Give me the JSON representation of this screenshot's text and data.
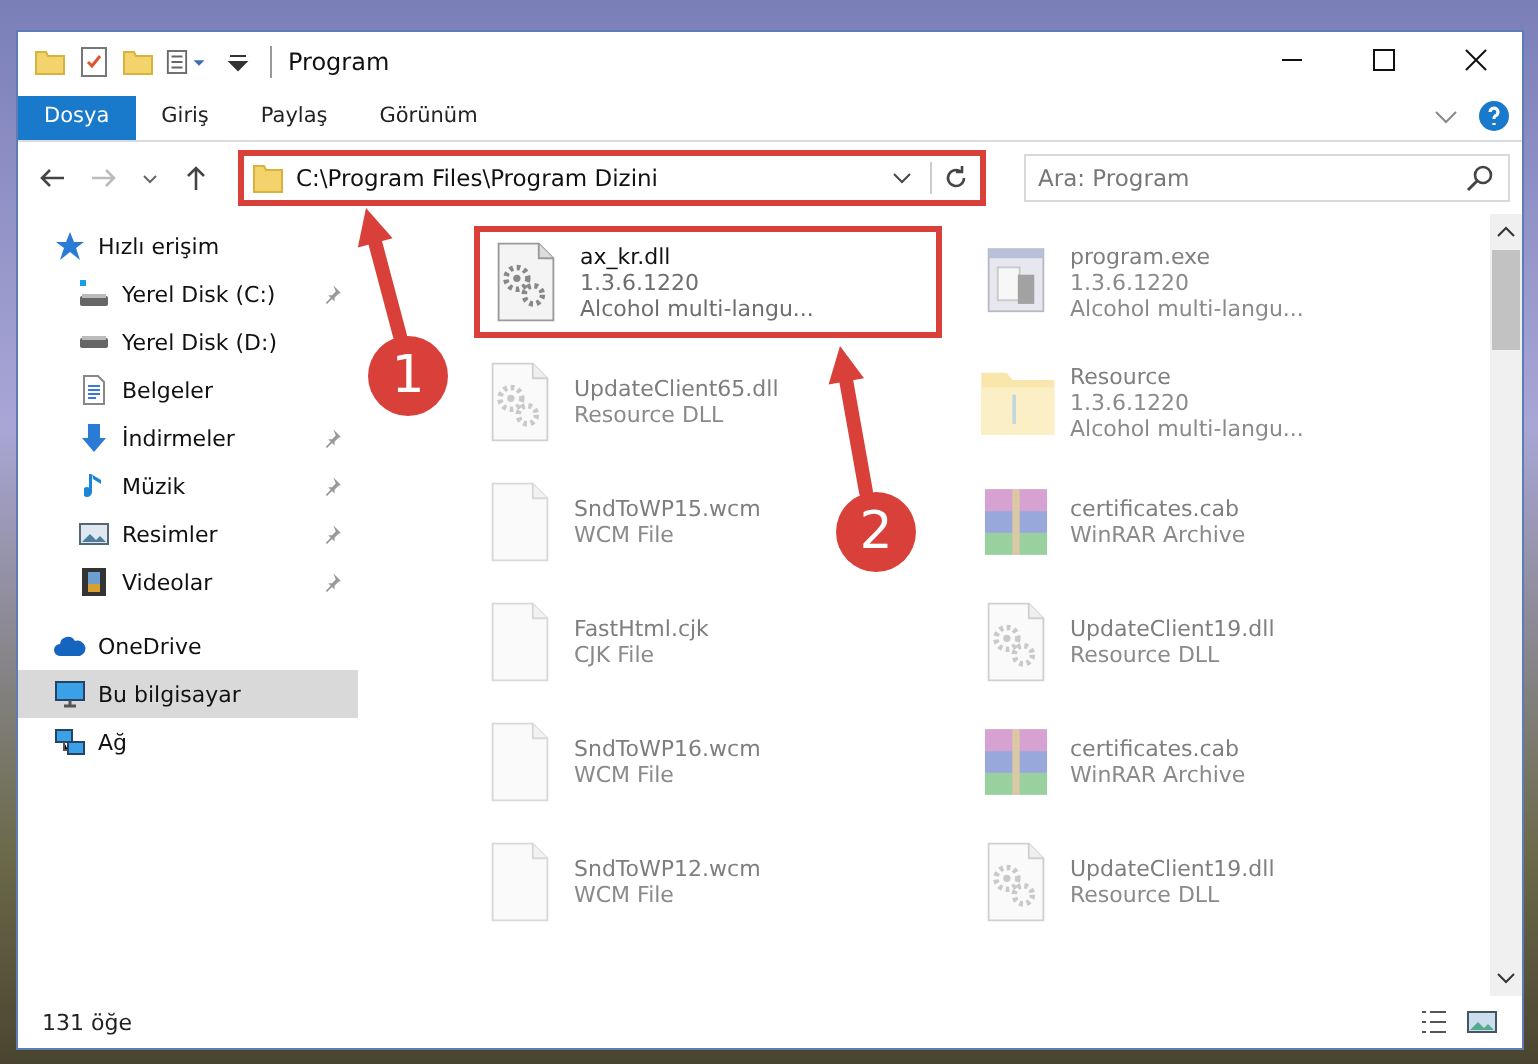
{
  "window": {
    "title": "Program"
  },
  "ribbon_tabs": [
    {
      "label": "Dosya",
      "selected": true
    },
    {
      "label": "Giriş",
      "selected": false
    },
    {
      "label": "Paylaş",
      "selected": false
    },
    {
      "label": "Görünüm",
      "selected": false
    }
  ],
  "address_bar": {
    "value": "C:\\Program Files\\Program Dizini",
    "highlighted": true
  },
  "search": {
    "placeholder": "Ara: Program"
  },
  "sidebar": {
    "items": [
      {
        "label": "Hızlı erişim",
        "kind": "star",
        "selected": false,
        "children": [
          {
            "label": "Yerel Disk (C:)",
            "kind": "drive-c",
            "pinned": true
          },
          {
            "label": "Yerel Disk (D:)",
            "kind": "drive",
            "pinned": false
          },
          {
            "label": "Belgeler",
            "kind": "docs",
            "pinned": false
          },
          {
            "label": "İndirmeler",
            "kind": "download",
            "pinned": true
          },
          {
            "label": "Müzik",
            "kind": "music",
            "pinned": true
          },
          {
            "label": "Resimler",
            "kind": "pictures",
            "pinned": true
          },
          {
            "label": "Videolar",
            "kind": "videos",
            "pinned": true
          }
        ]
      },
      {
        "label": "OneDrive",
        "kind": "cloud",
        "selected": false
      },
      {
        "label": "Bu bilgisayar",
        "kind": "computer",
        "selected": true
      },
      {
        "label": "Ağ",
        "kind": "network",
        "selected": false
      }
    ]
  },
  "files": [
    {
      "name": "ax_kr.dll",
      "lines": [
        "1.3.6.1220",
        "Alcohol multi-langu..."
      ],
      "kind": "dll",
      "dimmed": false,
      "highlighted": true
    },
    {
      "name": "program.exe",
      "lines": [
        "1.3.6.1220",
        "Alcohol multi-langu..."
      ],
      "kind": "exe",
      "dimmed": true,
      "highlighted": false
    },
    {
      "name": "UpdateClient65.dll",
      "lines": [
        "Resource DLL"
      ],
      "kind": "dll",
      "dimmed": true,
      "highlighted": false
    },
    {
      "name": "Resource",
      "lines": [
        "1.3.6.1220",
        "Alcohol multi-langu..."
      ],
      "kind": "folder",
      "dimmed": true,
      "highlighted": false
    },
    {
      "name": "SndToWP15.wcm",
      "lines": [
        "WCM File"
      ],
      "kind": "doc",
      "dimmed": true,
      "highlighted": false
    },
    {
      "name": "certificates.cab",
      "lines": [
        "WinRAR Archive"
      ],
      "kind": "cab",
      "dimmed": true,
      "highlighted": false
    },
    {
      "name": "FastHtml.cjk",
      "lines": [
        "CJK File"
      ],
      "kind": "doc",
      "dimmed": true,
      "highlighted": false
    },
    {
      "name": "UpdateClient19.dll",
      "lines": [
        "Resource DLL"
      ],
      "kind": "dll",
      "dimmed": true,
      "highlighted": false
    },
    {
      "name": "SndToWP16.wcm",
      "lines": [
        "WCM File"
      ],
      "kind": "doc",
      "dimmed": true,
      "highlighted": false
    },
    {
      "name": "certificates.cab",
      "lines": [
        "WinRAR Archive"
      ],
      "kind": "cab",
      "dimmed": true,
      "highlighted": false
    },
    {
      "name": "SndToWP12.wcm",
      "lines": [
        "WCM File"
      ],
      "kind": "doc",
      "dimmed": true,
      "highlighted": false
    },
    {
      "name": "UpdateClient19.dll",
      "lines": [
        "Resource DLL"
      ],
      "kind": "dll",
      "dimmed": true,
      "highlighted": false
    }
  ],
  "status_bar": {
    "count": "131 öğe"
  },
  "annotations": [
    {
      "number": "1"
    },
    {
      "number": "2"
    }
  ]
}
